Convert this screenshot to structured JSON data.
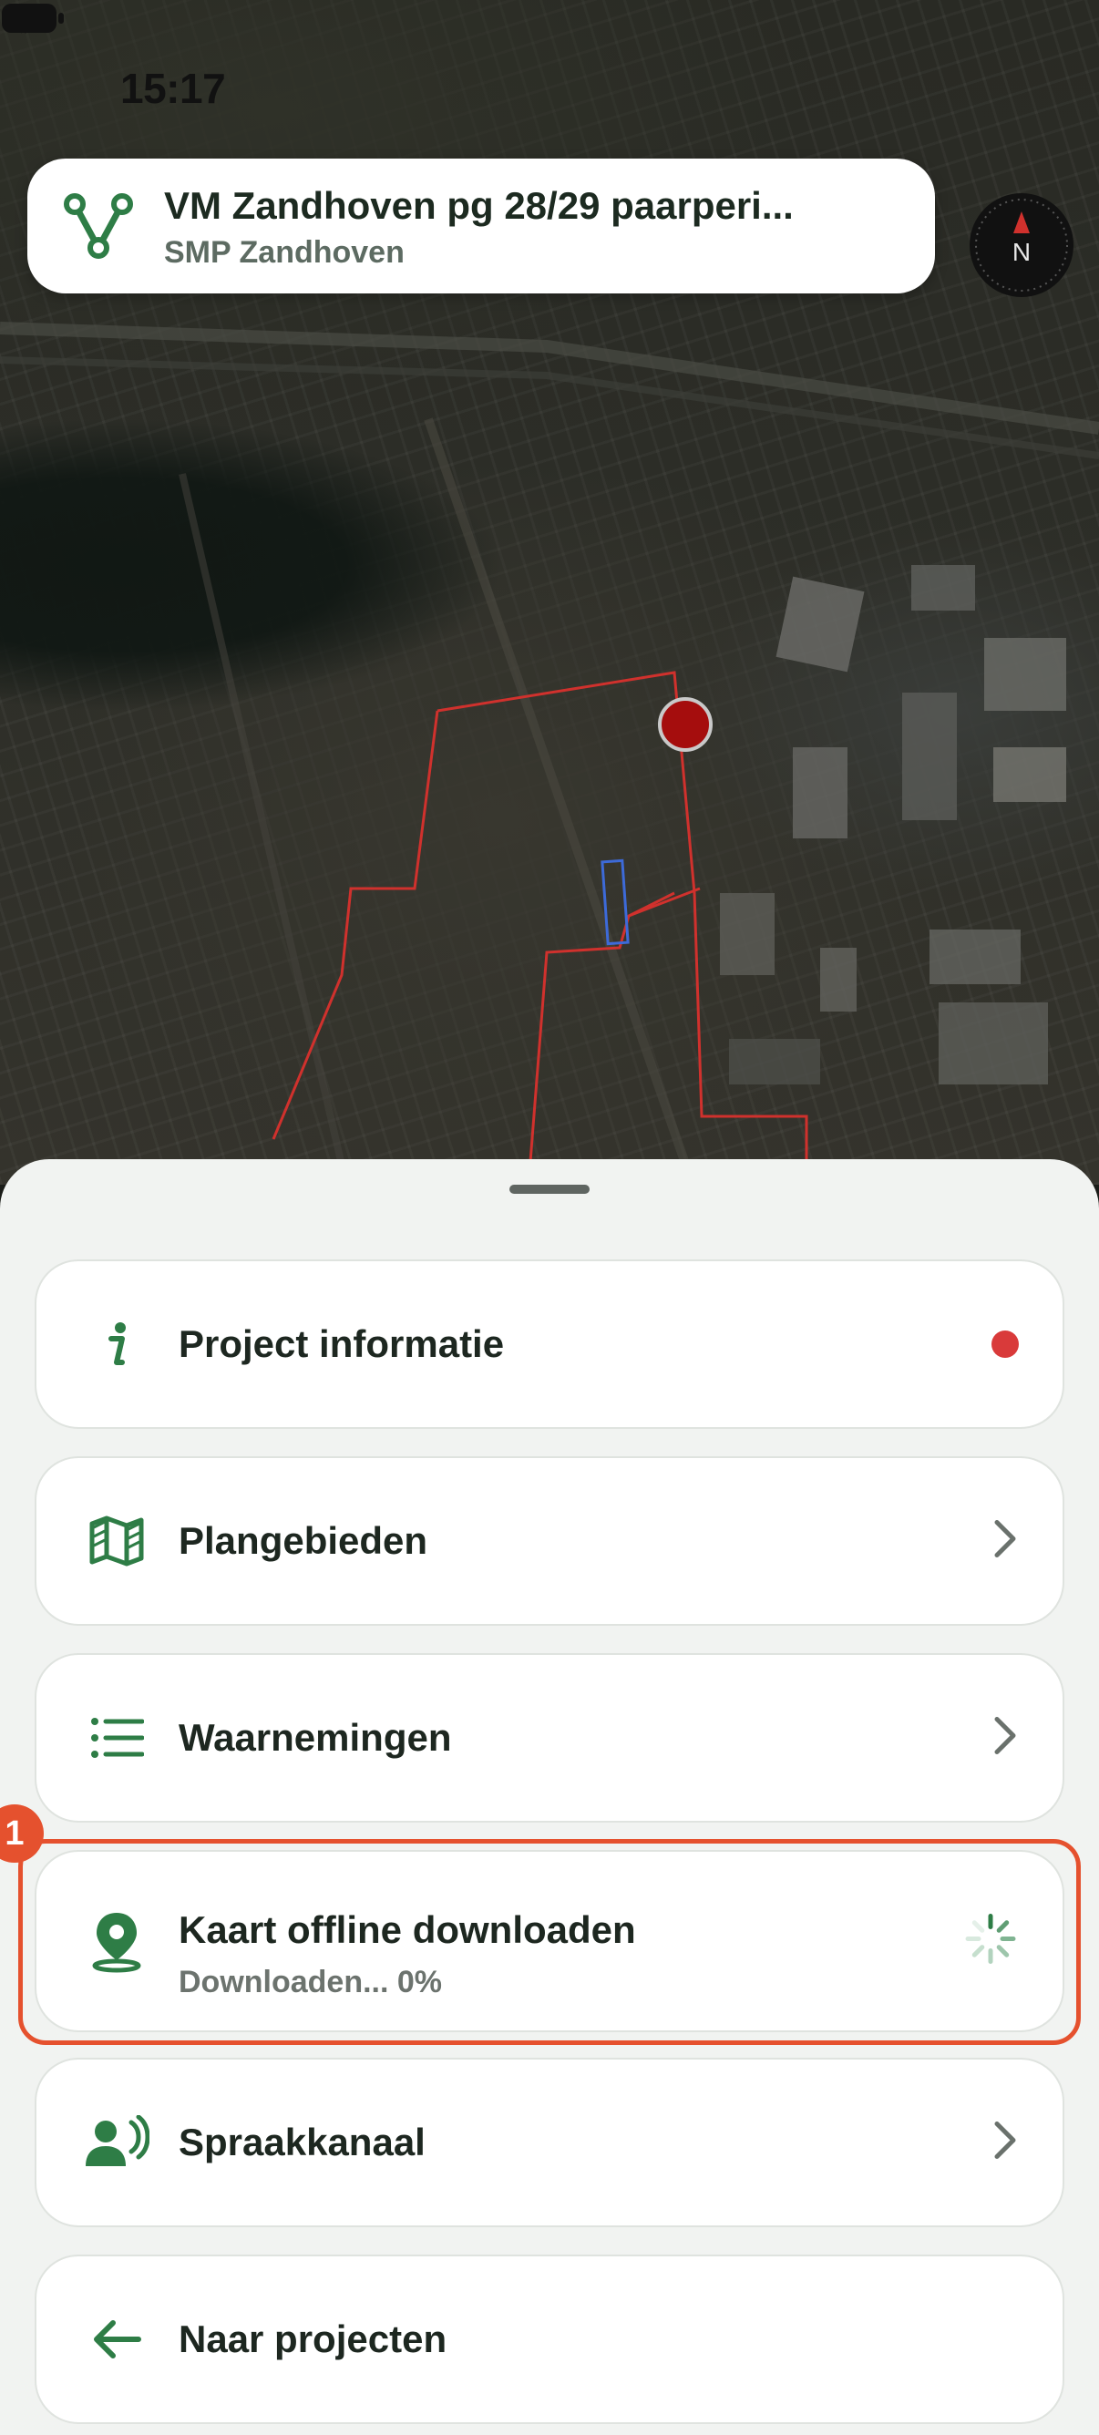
{
  "status_bar": {
    "time": "15:17"
  },
  "header": {
    "title": "VM Zandhoven pg 28/29 paarperi...",
    "subtitle": "SMP Zandhoven",
    "logo_icon": "v-route-icon"
  },
  "compass": {
    "label": "N"
  },
  "menu": {
    "items": [
      {
        "label": "Project informatie",
        "icon": "info-icon",
        "trailing": "red-dot"
      },
      {
        "label": "Plangebieden",
        "icon": "map-icon",
        "trailing": "chevron-right"
      },
      {
        "label": "Waarnemingen",
        "icon": "list-icon",
        "trailing": "chevron-right"
      },
      {
        "label": "Kaart offline downloaden",
        "sublabel": "Downloaden... 0%",
        "icon": "location-pin-icon",
        "trailing": "spinner"
      },
      {
        "label": "Spraakkanaal",
        "icon": "voice-icon",
        "trailing": "chevron-right"
      },
      {
        "label": "Naar projecten",
        "icon": "arrow-left-icon",
        "trailing": ""
      }
    ]
  },
  "annotation": {
    "badge": "1"
  },
  "colors": {
    "accent_green": "#2e7d46",
    "highlight_orange": "#e5512e",
    "notification_red": "#d93a3a"
  }
}
